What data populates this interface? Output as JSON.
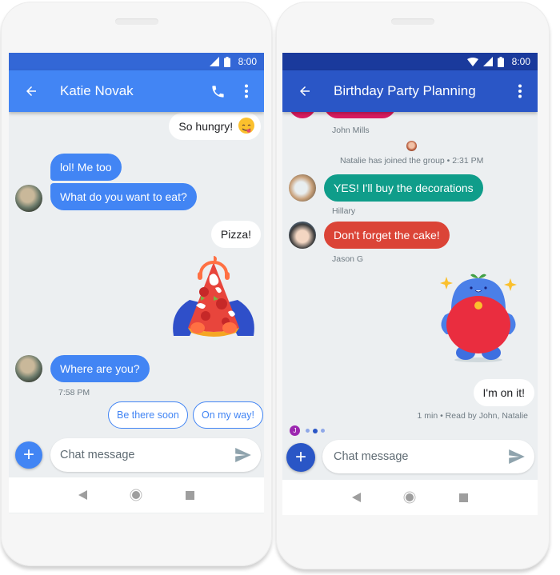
{
  "phones": {
    "left": {
      "status": {
        "time": "8:00",
        "icons": [
          "signal-icon",
          "battery-icon"
        ]
      },
      "appbar": {
        "title": "Katie Novak",
        "back_icon": "arrow-back-icon",
        "actions": [
          "phone-icon",
          "more-vert-icon"
        ]
      },
      "messages": [
        {
          "type": "out",
          "text": "So hungry!",
          "emoji": "😋"
        },
        {
          "type": "in",
          "text": "lol! Me too"
        },
        {
          "type": "in",
          "text": "What do you want to eat?"
        },
        {
          "type": "out",
          "text": "Pizza!"
        },
        {
          "type": "sticker",
          "name": "pizza-sticker"
        },
        {
          "type": "in",
          "text": "Where are you?"
        }
      ],
      "timestamp": "7:58 PM",
      "smart_replies": [
        "Be there soon",
        "On my way!"
      ],
      "composer": {
        "placeholder": "Chat message"
      }
    },
    "right": {
      "status": {
        "time": "8:00",
        "icons": [
          "wifi-icon",
          "signal-icon",
          "battery-icon"
        ]
      },
      "appbar": {
        "title": "Birthday Party Planning",
        "back_icon": "arrow-back-icon",
        "actions": [
          "more-vert-icon"
        ]
      },
      "sender_john": "John Mills",
      "system_event": "Natalie has joined the group • 2:31 PM",
      "messages": [
        {
          "type": "in",
          "text": "YES! I'll buy the decorations",
          "sender": "Hillary",
          "color": "#0f9d8a"
        },
        {
          "type": "in",
          "text": "Don't forget the cake!",
          "sender": "Jason G",
          "color": "#db4437"
        },
        {
          "type": "sticker",
          "name": "blue-creature-sticker"
        },
        {
          "type": "out",
          "text": "I'm on it!"
        }
      ],
      "read_receipt": "1 min • Read by John, Natalie",
      "typing": {
        "initial": "J",
        "color": "#9c27b0"
      },
      "composer": {
        "placeholder": "Chat message"
      }
    }
  },
  "colors": {
    "left_appbar": "#4285f4",
    "right_appbar": "#2a56c6",
    "hillary_bubble": "#0f9d8a",
    "jason_bubble": "#db4437",
    "john_bubble": "#d81b60"
  }
}
